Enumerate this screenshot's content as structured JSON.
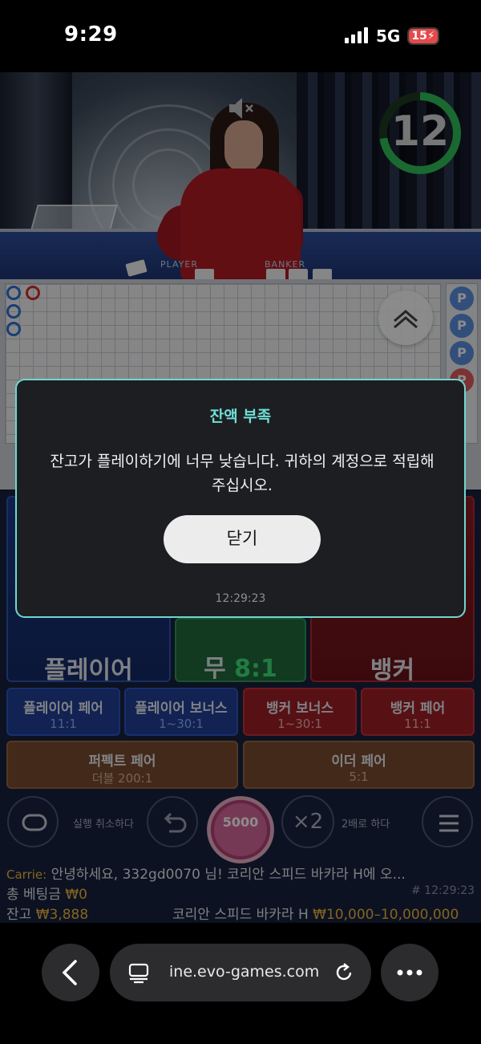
{
  "status_bar": {
    "time": "9:29",
    "network": "5G",
    "battery": "15"
  },
  "video": {
    "timer": "12",
    "table_player_label": "PLAYER",
    "table_banker_label": "BANKER",
    "timer_color": "#2fbf5a"
  },
  "roadmap": {
    "p_badge": "P"
  },
  "bets": {
    "player": "플레이어",
    "tie": "무",
    "tie_odds": "8:1",
    "banker": "뱅커",
    "side": [
      {
        "name": "플레이어 페어",
        "odds": "11:1"
      },
      {
        "name": "플레이어 보너스",
        "odds": "1~30:1"
      },
      {
        "name": "뱅커 보너스",
        "odds": "1~30:1"
      },
      {
        "name": "뱅커 페어",
        "odds": "11:1"
      }
    ],
    "perfect_pair": {
      "name": "퍼펙트 페어",
      "odds": "더블 200:1"
    },
    "either_pair": {
      "name": "이더 페어",
      "odds": "5:1"
    }
  },
  "controls": {
    "undo_label": "실행 취소하다",
    "chip_value": "5000",
    "double_symbol": "×2",
    "double_label": "2배로 하다"
  },
  "info": {
    "chat_name": "Carrie:",
    "chat_message": "안녕하세요, 332gd0070 님! 코리안 스피드 바카라 H에 오...",
    "total_bet_label": "총 베팅금",
    "total_bet_value": "₩0",
    "round_id": "# 12:29:23",
    "balance_label": "잔고",
    "balance_value": "₩3,888",
    "table_name": "코리안 스피드 바카라 H",
    "bet_limits": "₩10,000–10,000,000"
  },
  "modal": {
    "title": "잔액 부족",
    "message": "잔고가 플레이하기에 너무 낮습니다. 귀하의 계정으로 적립해 주십시오.",
    "close_label": "닫기",
    "time": "12:29:23"
  },
  "browser": {
    "url": "ine.evo-games.com"
  }
}
